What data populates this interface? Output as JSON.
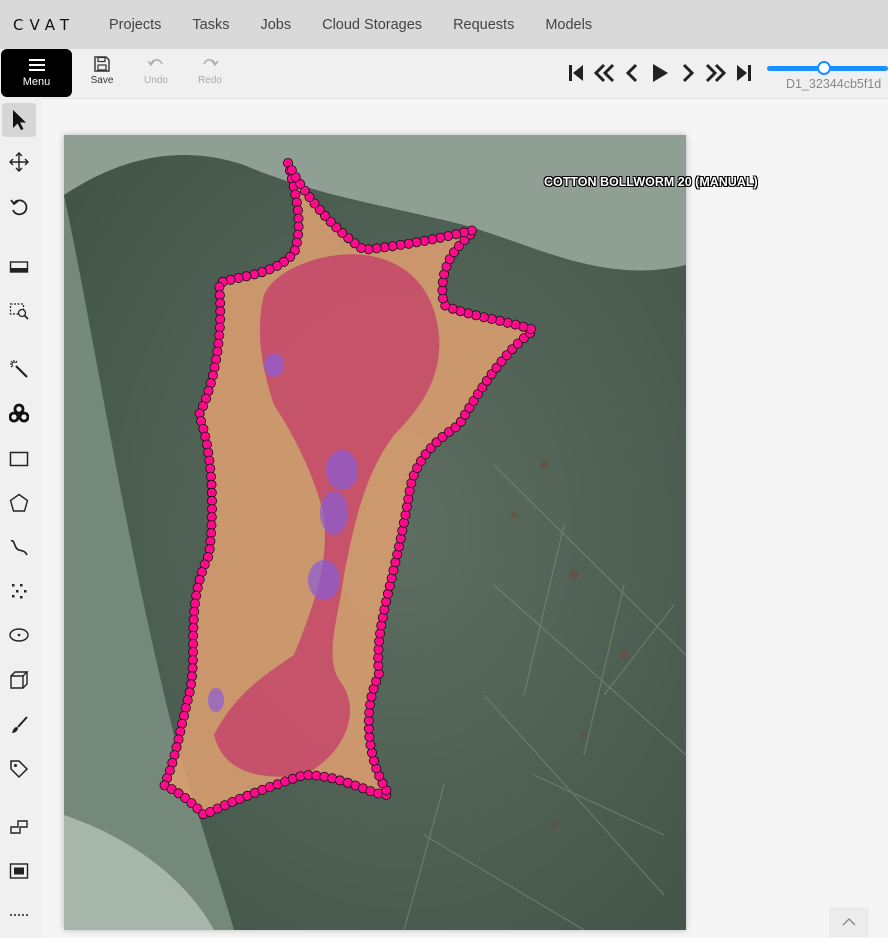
{
  "app": {
    "logo": "CVAT"
  },
  "nav": {
    "links": [
      "Projects",
      "Tasks",
      "Jobs",
      "Cloud Storages",
      "Requests",
      "Models"
    ]
  },
  "toolbar": {
    "menu_label": "Menu",
    "save_label": "Save",
    "undo_label": "Undo",
    "redo_label": "Redo",
    "frame_name": "D1_32344cb5f1d",
    "frame_slider_position": 0.47
  },
  "sidebar": {
    "icons": [
      "cursor-icon",
      "move-icon",
      "rotate-icon",
      "fit-image-icon",
      "zoom-region-icon",
      "magic-wand-icon",
      "opencv-icon",
      "rectangle-icon",
      "polygon-icon",
      "polyline-icon",
      "points-icon",
      "ellipse-icon",
      "cuboid-icon",
      "brush-icon",
      "tag-icon",
      "merge-icon",
      "group-icon",
      "more-icon"
    ]
  },
  "canvas": {
    "object_label": "COTTON BOLLWORM 20 (MANUAL)"
  },
  "colors": {
    "accent": "#1890ff",
    "polygon_stroke": "#ff0a8c",
    "topnav_bg": "#d9d9d9"
  }
}
